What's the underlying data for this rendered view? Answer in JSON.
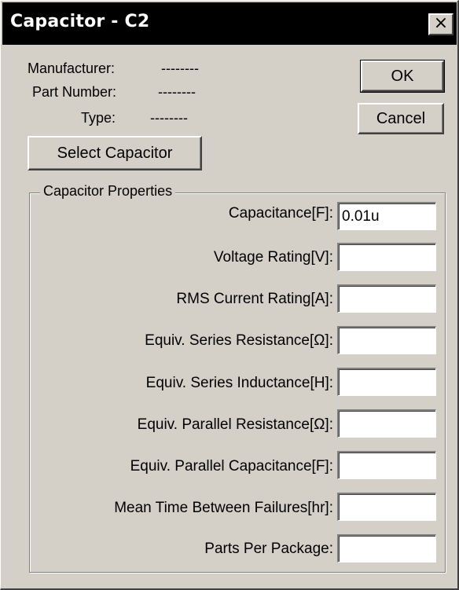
{
  "window": {
    "title": "Capacitor - C2",
    "close_glyph": "×"
  },
  "info": {
    "manufacturer_label": "Manufacturer:",
    "manufacturer_value": "--------",
    "part_number_label": "Part Number:",
    "part_number_value": "--------",
    "type_label": "Type:",
    "type_value": "--------"
  },
  "buttons": {
    "ok": "OK",
    "cancel": "Cancel",
    "select_capacitor": "Select Capacitor"
  },
  "properties": {
    "group_title": "Capacitor Properties",
    "fields": [
      {
        "label": "Capacitance[F]:",
        "value": "0.01u"
      },
      {
        "label": "Voltage Rating[V]:",
        "value": ""
      },
      {
        "label": "RMS Current Rating[A]:",
        "value": ""
      },
      {
        "label": "Equiv. Series Resistance[Ω]:",
        "value": ""
      },
      {
        "label": "Equiv. Series Inductance[H]:",
        "value": ""
      },
      {
        "label": "Equiv. Parallel Resistance[Ω]:",
        "value": ""
      },
      {
        "label": "Equiv. Parallel Capacitance[F]:",
        "value": ""
      },
      {
        "label": "Mean Time Between Failures[hr]:",
        "value": ""
      },
      {
        "label": "Parts Per Package:",
        "value": ""
      }
    ]
  },
  "colors": {
    "dialog_bg": "#d4d0c8",
    "titlebar_bg": "#000000",
    "titlebar_text": "#ffffff",
    "input_bg": "#ffffff"
  }
}
